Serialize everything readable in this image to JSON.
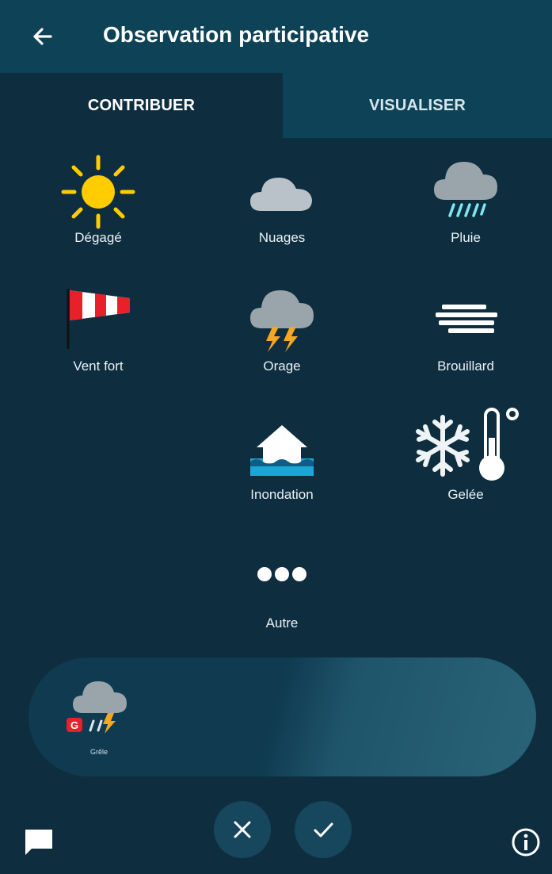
{
  "header": {
    "title": "Observation participative",
    "back_icon": "arrow-left-icon"
  },
  "tabs": [
    {
      "label": "CONTRIBUER",
      "active": true
    },
    {
      "label": "VISUALISER",
      "active": false
    }
  ],
  "observations": [
    {
      "label": "Dégagé",
      "icon": "sun-icon"
    },
    {
      "label": "Nuages",
      "icon": "cloud-icon"
    },
    {
      "label": "Pluie",
      "icon": "rain-cloud-icon"
    },
    {
      "label": "Vent fort",
      "icon": "windsock-icon"
    },
    {
      "label": "Orage",
      "icon": "thunderstorm-icon"
    },
    {
      "label": "Brouillard",
      "icon": "fog-icon"
    },
    {
      "label": "Inondation",
      "icon": "flood-icon"
    },
    {
      "label": "Gelée",
      "icon": "frost-icon"
    },
    {
      "label": "Autre",
      "icon": "more-dots-icon"
    }
  ],
  "selection": {
    "label": "Grêle",
    "icon": "hail-storm-icon",
    "badge": "G"
  },
  "actions": {
    "cancel_icon": "close-icon",
    "confirm_icon": "check-icon"
  },
  "footer": {
    "left_icon": "chat-bubble-icon",
    "right_icon": "info-icon"
  },
  "colors": {
    "header_bg": "#0e4357",
    "page_bg": "#0e2e40",
    "sun": "#ffcc00",
    "windsock_red": "#e8202a",
    "lightning": "#f5a623"
  }
}
